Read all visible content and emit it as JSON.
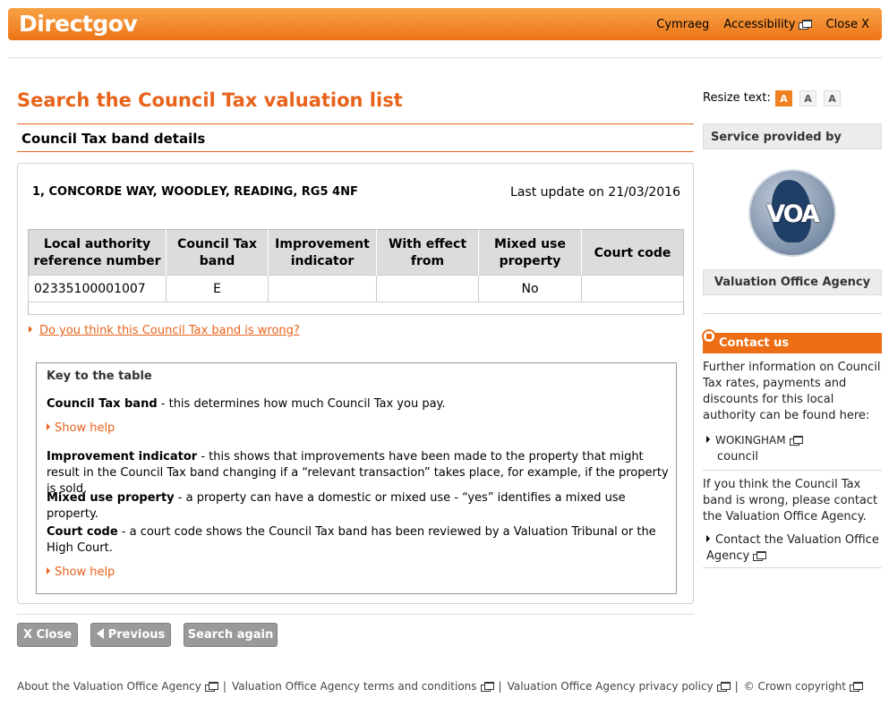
{
  "header": {
    "logo": "Directgov",
    "links": {
      "cymraeg": "Cymraeg",
      "accessibility": "Accessibility",
      "close": "Close X"
    }
  },
  "page": {
    "title": "Search the Council Tax valuation list",
    "section_title": "Council Tax band details",
    "address": "1, CONCORDE WAY, WOODLEY, READING, RG5 4NF",
    "last_update": "Last update on 21/03/2016",
    "table": {
      "headers": [
        "Local authority reference number",
        "Council Tax band",
        "Improvement indicator",
        "With effect from",
        "Mixed use property",
        "Court code"
      ],
      "row": [
        "02335100001007",
        "E",
        "",
        "",
        "No",
        ""
      ]
    },
    "wrong_link": "Do you think this Council Tax band is wrong?"
  },
  "key": {
    "title": "Key to the table",
    "band_term": "Council Tax band",
    "band_desc": " -  this determines how much Council Tax you pay.",
    "show_help": "Show help",
    "improvement_term": "Improvement indicator",
    "improvement_desc": " -  this shows that improvements have been made to the property that might result in the Council Tax band changing if a “relevant transaction” takes place, for example, if the property is sold.",
    "mixed_term": "Mixed use property",
    "mixed_desc": " -  a property can have a domestic or mixed use - “yes” identifies a mixed use property.",
    "court_term": "Court code",
    "court_desc": " -  a court code shows the Council Tax band has been reviewed by a Valuation Tribunal or the High Court."
  },
  "buttons": {
    "close": "X Close",
    "previous": "Previous",
    "search_again": "Search again"
  },
  "footer": {
    "about": "About the Valuation Office Agency",
    "terms": "Valuation Office Agency terms and conditions",
    "privacy": "Valuation Office Agency privacy policy",
    "copyright": "© Crown copyright",
    "sep": "|"
  },
  "sidebar": {
    "resize_label": "Resize text:",
    "resize_options": [
      "A",
      "A",
      "A"
    ],
    "service_heading": "Service provided by",
    "logo_text": "VOA",
    "agency_name": "Valuation Office Agency",
    "contact_heading": "Contact us",
    "contact_text": "Further information on Council Tax rates, payments and discounts for this local authority can be found here:",
    "council_link": "WOKINGHAM",
    "council_suffix": "council",
    "wrong_text": "If you think the Council Tax band is wrong, please contact the Valuation Office Agency.",
    "contact_voa_link": "Contact the Valuation Office Agency"
  },
  "colors": {
    "brand_orange": "#ec6d14",
    "title_orange": "#e8631a",
    "button_gray": "#9a9a9a"
  },
  "icons": [
    "new-window-icon",
    "arrow-left-icon",
    "contact-pin-icon",
    "triangle-bullet-icon"
  ]
}
